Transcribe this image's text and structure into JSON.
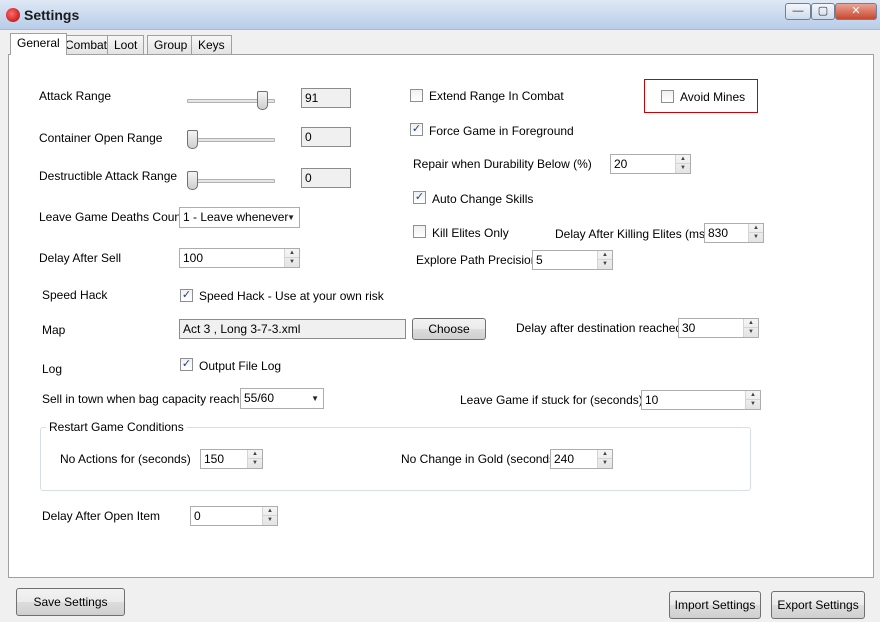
{
  "window": {
    "title": "Settings",
    "minimize_glyph": "—",
    "maximize_glyph": "▢",
    "close_glyph": "✕"
  },
  "tabs": [
    {
      "label": "General"
    },
    {
      "label": "Combat"
    },
    {
      "label": "Loot"
    },
    {
      "label": "Group"
    },
    {
      "label": "Keys"
    }
  ],
  "general": {
    "attack_range": {
      "label": "Attack Range",
      "value": "91",
      "slider_fraction": 0.91
    },
    "container_open_range": {
      "label": "Container Open Range",
      "value": "0",
      "slider_fraction": 0
    },
    "destructible_attack_range": {
      "label": "Destructible Attack Range",
      "value": "0",
      "slider_fraction": 0
    },
    "leave_game_deaths_count": {
      "label": "Leave Game Deaths Count",
      "value": "1 - Leave whenever"
    },
    "delay_after_sell": {
      "label": "Delay After Sell",
      "value": "100"
    },
    "speed_hack": {
      "label": "Speed Hack",
      "checkbox_label": "Speed Hack - Use at your own risk",
      "checked": true
    },
    "map": {
      "label": "Map",
      "value": "Act 3 , Long 3-7-3.xml",
      "choose_label": "Choose"
    },
    "log": {
      "label": "Log",
      "checkbox_label": "Output File Log",
      "checked": true
    },
    "sell_in_town": {
      "label": "Sell in town when bag capacity reaches",
      "value": "55/60"
    },
    "restart_conditions": {
      "title": "Restart Game Conditions",
      "no_actions": {
        "label": "No Actions for (seconds)",
        "value": "150"
      },
      "no_gold_change": {
        "label": "No Change in Gold (seconds)",
        "value": "240"
      }
    },
    "delay_after_open_item": {
      "label": "Delay After Open Item",
      "value": "0"
    },
    "extend_range_in_combat": {
      "label": "Extend Range In Combat",
      "checked": false
    },
    "avoid_mines": {
      "label": "Avoid Mines",
      "checked": false
    },
    "force_game_foreground": {
      "label": "Force Game in Foreground",
      "checked": true
    },
    "repair_durability": {
      "label": "Repair when Durability Below (%)",
      "value": "20"
    },
    "auto_change_skills": {
      "label": "Auto Change Skills",
      "checked": true
    },
    "kill_elites_only": {
      "label": "Kill Elites Only",
      "checked": false
    },
    "delay_after_killing_elites": {
      "label": "Delay After Killing Elites (ms)",
      "value": "830"
    },
    "explore_path_precision": {
      "label": "Explore Path Precision",
      "value": "5"
    },
    "delay_after_destination": {
      "label": "Delay after destination reached",
      "value": "30"
    },
    "leave_game_if_stuck": {
      "label": "Leave Game if stuck for (seconds)",
      "value": "10"
    }
  },
  "footer": {
    "save_label": "Save Settings",
    "import_label": "Import Settings",
    "export_label": "Export Settings"
  },
  "glyphs": {
    "check": "✓",
    "spin_up": "▲",
    "spin_down": "▼",
    "dropdown": "▼"
  },
  "colors": {
    "highlight_border": "#cc0000",
    "titlebar": "#c9d9ee"
  }
}
